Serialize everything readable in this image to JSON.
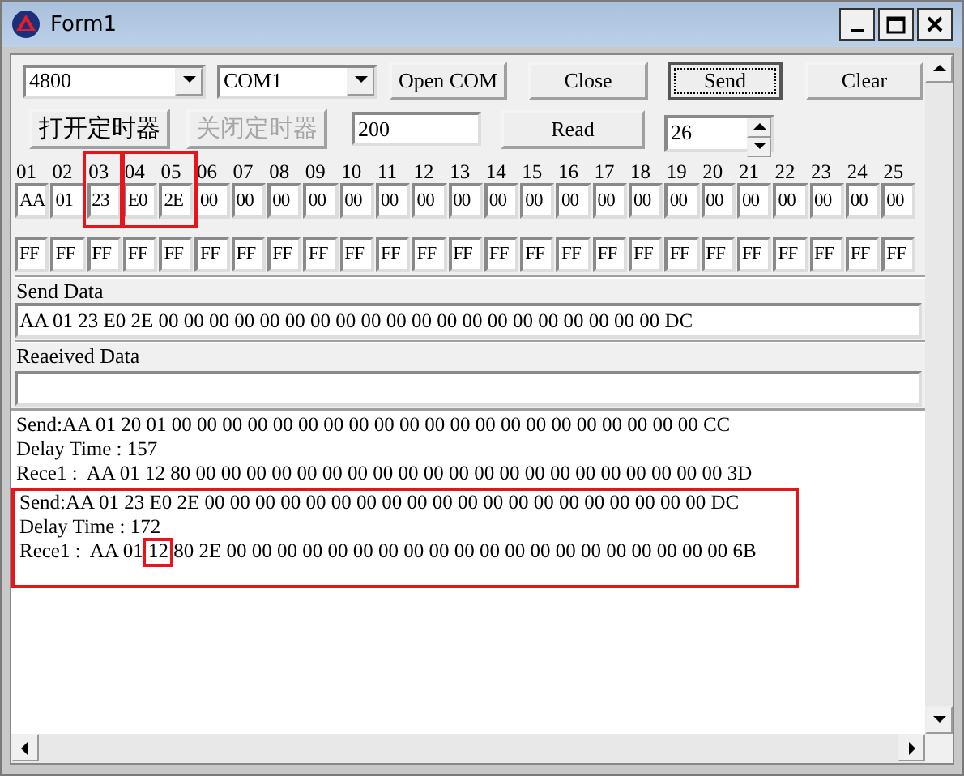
{
  "window": {
    "title": "Form1"
  },
  "baud_combo": {
    "value": "4800"
  },
  "port_combo": {
    "value": "COM1"
  },
  "top_buttons": [
    {
      "label": "Open COM",
      "focused": false
    },
    {
      "label": "Close",
      "focused": false
    },
    {
      "label": "Send",
      "focused": true
    },
    {
      "label": "Clear",
      "focused": false
    }
  ],
  "timer_buttons": [
    {
      "label": "打开定时器",
      "disabled": false
    },
    {
      "label": "关闭定时器",
      "disabled": true
    }
  ],
  "interval_field": {
    "value": "200"
  },
  "read_button": {
    "label": "Read"
  },
  "length_spinner": {
    "value": "26"
  },
  "byte_columns": [
    {
      "header": "01",
      "value": "AA",
      "mask": "FF"
    },
    {
      "header": "02",
      "value": "01",
      "mask": "FF"
    },
    {
      "header": "03",
      "value": "23",
      "mask": "FF"
    },
    {
      "header": "04",
      "value": "E0",
      "mask": "FF"
    },
    {
      "header": "05",
      "value": "2E",
      "mask": "FF"
    },
    {
      "header": "06",
      "value": "00",
      "mask": "FF"
    },
    {
      "header": "07",
      "value": "00",
      "mask": "FF"
    },
    {
      "header": "08",
      "value": "00",
      "mask": "FF"
    },
    {
      "header": "09",
      "value": "00",
      "mask": "FF"
    },
    {
      "header": "10",
      "value": "00",
      "mask": "FF"
    },
    {
      "header": "11",
      "value": "00",
      "mask": "FF"
    },
    {
      "header": "12",
      "value": "00",
      "mask": "FF"
    },
    {
      "header": "13",
      "value": "00",
      "mask": "FF"
    },
    {
      "header": "14",
      "value": "00",
      "mask": "FF"
    },
    {
      "header": "15",
      "value": "00",
      "mask": "FF"
    },
    {
      "header": "16",
      "value": "00",
      "mask": "FF"
    },
    {
      "header": "17",
      "value": "00",
      "mask": "FF"
    },
    {
      "header": "18",
      "value": "00",
      "mask": "FF"
    },
    {
      "header": "19",
      "value": "00",
      "mask": "FF"
    },
    {
      "header": "20",
      "value": "00",
      "mask": "FF"
    },
    {
      "header": "21",
      "value": "00",
      "mask": "FF"
    },
    {
      "header": "22",
      "value": "00",
      "mask": "FF"
    },
    {
      "header": "23",
      "value": "00",
      "mask": "FF"
    },
    {
      "header": "24",
      "value": "00",
      "mask": "FF"
    },
    {
      "header": "25",
      "value": "00",
      "mask": "FF"
    }
  ],
  "send_data": {
    "label": "Send Data",
    "value": "AA 01 23 E0 2E 00 00 00 00 00 00 00 00 00 00 00 00 00 00 00 00 00 00 00 00 DC"
  },
  "received_data": {
    "label": "Reaeived Data"
  },
  "log_lines": [
    "Send:AA 01 20 01 00 00 00 00 00 00 00 00 00 00 00 00 00 00 00 00 00 00 00 00 00 CC",
    "Delay Time : 157",
    "Rece1 :  AA 01 12 80 00 00 00 00 00 00 00 00 00 00 00 00 00 00 00 00 00 00 00 00 00 3D",
    "Send:AA 01 23 E0 2E 00 00 00 00 00 00 00 00 00 00 00 00 00 00 00 00 00 00 00 00 DC",
    "Delay Time : 172",
    "Rece1 :  AA 01 12 80 2E 00 00 00 00 00 00 00 00 00 00 00 00 00 00 00 00 00 00 00 00 6B"
  ]
}
